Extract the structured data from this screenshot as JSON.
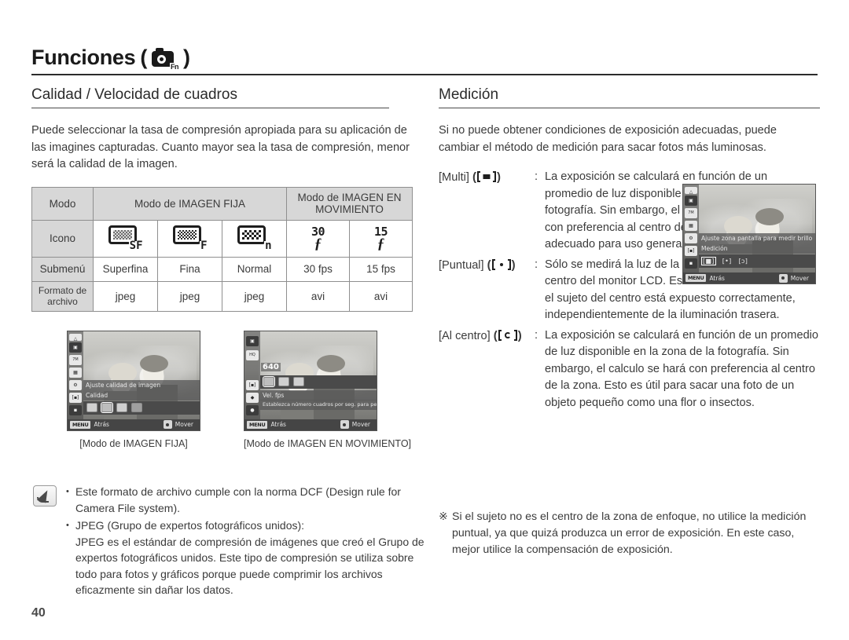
{
  "header": {
    "title": "Funciones",
    "paren_open": "(",
    "paren_close": ")",
    "icon": "camera-fn-icon",
    "icon_label": "Fn"
  },
  "page_number": "40",
  "left": {
    "section_title": "Calidad / Velocidad de cuadros",
    "intro": "Puede seleccionar la tasa de compresión apropiada para su aplicación de las imagines capturadas. Cuanto mayor sea la tasa de compresión, menor será la calidad de la imagen.",
    "table": {
      "row_labels": [
        "Modo",
        "Icono",
        "Submenú",
        "Formato de archivo"
      ],
      "group_headers": [
        "Modo de IMAGEN FIJA",
        "Modo de IMAGEN EN MOVIMIENTO"
      ],
      "icons": [
        "SF",
        "F",
        "n",
        "30",
        "15"
      ],
      "submenu": [
        "Superfina",
        "Fina",
        "Normal",
        "30 fps",
        "15 fps"
      ],
      "file_format": [
        "jpeg",
        "jpeg",
        "jpeg",
        "avi",
        "avi"
      ]
    },
    "lcd_still": {
      "caption": "[Modo de IMAGEN FIJA]",
      "tip_line1": "Ajuste calidad de imagen",
      "tip_line2": "Calidad",
      "back_label": "Atrás",
      "move_label": "Mover",
      "menu_key": "MENU"
    },
    "lcd_movie": {
      "caption": "[Modo de IMAGEN EN MOVIMIENTO]",
      "resolution": "640",
      "tip_line1": "Vel. fps",
      "tip_line2": "Establezca número cuadros por seg. para pelíc.",
      "back_label": "Atrás",
      "move_label": "Mover",
      "menu_key": "MENU"
    },
    "notes": [
      "Este formato de archivo cumple con la norma DCF (Design rule for Camera File system).",
      "JPEG (Grupo de expertos fotográficos unidos):"
    ],
    "note_continuation": "JPEG es el estándar de compresión de imágenes que creó el Grupo de expertos fotográficos unidos. Este tipo de compresión se utiliza sobre todo para fotos y gráficos porque puede comprimir los archivos eficazmente sin dañar los datos."
  },
  "right": {
    "section_title": "Medición",
    "intro": "Si no puede obtener condiciones de exposición adecuadas, puede cambiar el método de medición para sacar fotos más luminosas.",
    "items": [
      {
        "key": "[Multi]",
        "icon": "metering-multi-icon",
        "colon": ":",
        "text": "La exposición se calculará en función de un promedio de luz disponible en la zona de la fotografía. Sin embargo, el calculo se hará con preferencia al centro de la zona. Esto es adecuado para uso general.",
        "narrow": true
      },
      {
        "key": "[Puntual]",
        "icon": "metering-spot-icon",
        "colon": ":",
        "text": "Sólo se medirá la luz de la zona rectangular del centro del monitor LCD. Esto se recomienda cuando el sujeto del centro está expuesto correctamente, independientemente de la iluminación trasera.",
        "narrow": false
      },
      {
        "key": "[Al centro]",
        "icon": "metering-center-icon",
        "colon": ":",
        "text": "La exposición se calculará en función de un promedio de luz disponible en la zona de la fotografía. Sin embargo, el calculo se hará con preferencia al centro de la zona. Esto es útil para sacar una foto de un objeto pequeño como una flor o insectos.",
        "narrow": false
      }
    ],
    "lcd": {
      "tip_line1": "Ajuste zona pantalla para medir brillo",
      "tip_line2": "Medición",
      "options": [
        "[■]",
        "[•]",
        "[ɔ]"
      ],
      "back_label": "Atrás",
      "move_label": "Mover",
      "menu_key": "MENU"
    },
    "footnote_marker": "※",
    "footnote": "Si el sujeto no es el centro de la zona de enfoque, no utilice la medición puntual, ya que quizá produzca un error de exposición. En este caso, mejor utilice la compensación de exposición."
  }
}
